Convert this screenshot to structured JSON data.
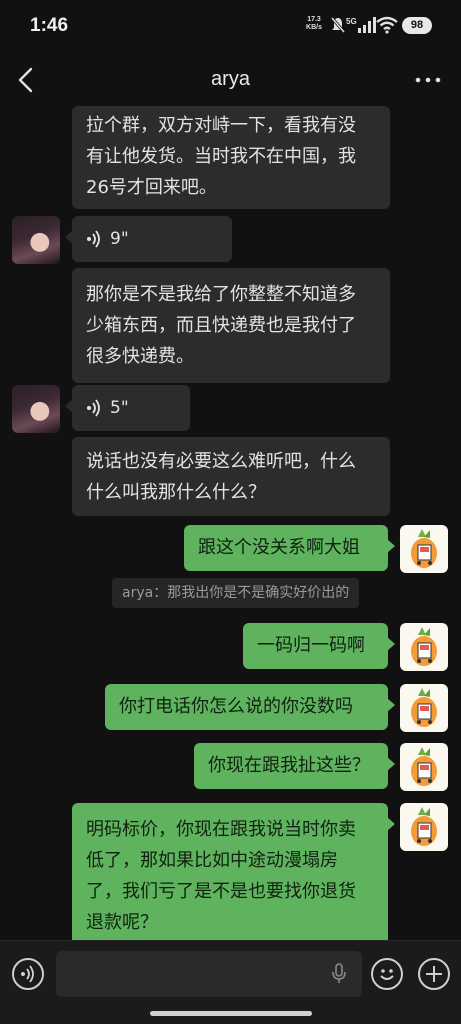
{
  "status": {
    "time": "1:46",
    "net_speed": "17.3",
    "net_unit": "KB/s",
    "battery": "98",
    "icons": [
      "mute-icon",
      "5g-signal-icon",
      "wifi-icon",
      "battery-icon"
    ]
  },
  "header": {
    "title": "arya",
    "back_icon": "chevron-left-icon",
    "more_icon": "more-horizontal-icon"
  },
  "messages": [
    {
      "side": "in",
      "type": "text",
      "lines": [
        "拉个群，双方对峙一下，看我有没",
        "有让他发货。当时我不在中国，我",
        "26号才回来吧。"
      ]
    },
    {
      "side": "in",
      "type": "voice",
      "duration": "9\""
    },
    {
      "side": "in",
      "type": "text",
      "lines": [
        "那你是不是我给了你整整不知道多",
        "少箱东西，而且快递费也是我付了",
        "很多快递费。"
      ]
    },
    {
      "side": "in",
      "type": "voice",
      "duration": "5\""
    },
    {
      "side": "in",
      "type": "text",
      "lines": [
        "说话也没有必要这么难听吧，什么",
        "什么叫我那什么什么？"
      ]
    },
    {
      "side": "out",
      "type": "text",
      "lines": [
        "跟这个没关系啊大姐"
      ]
    },
    {
      "side": "quote",
      "type": "quote",
      "text": "arya：那我出你是不是确实好价出的"
    },
    {
      "side": "out",
      "type": "text",
      "lines": [
        "一码归一码啊"
      ]
    },
    {
      "side": "out",
      "type": "text",
      "lines": [
        "你打电话你怎么说的你没数吗"
      ]
    },
    {
      "side": "out",
      "type": "text",
      "lines": [
        "你现在跟我扯这些？"
      ]
    },
    {
      "side": "out",
      "type": "text",
      "lines": [
        "明码标价，你现在跟我说当时你卖",
        "低了，那如果比如中途动漫塌房",
        "了，我们亏了是不是也要找你退货",
        "退款呢？"
      ]
    }
  ],
  "input": {
    "placeholder": ""
  },
  "colors": {
    "background": "#111111",
    "incoming": "#2c2c2c",
    "outgoing": "#5fb35f",
    "accent": "#5fb35f"
  }
}
